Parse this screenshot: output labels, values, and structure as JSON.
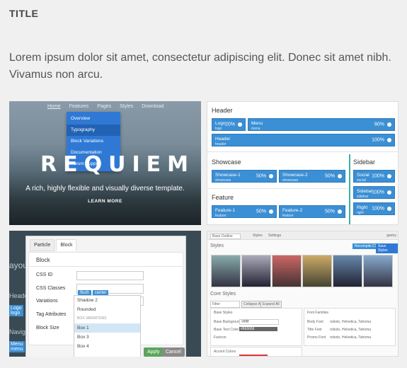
{
  "title": "TITLE",
  "lead": "Lorem ipsum dolor sit amet, consectetur adipiscing elit. Donec sit amet nibh. Vivamus non arcu.",
  "hero": {
    "nav": [
      "Home",
      "Features",
      "Pages",
      "Styles",
      "Download"
    ],
    "dropdown": [
      "Overview",
      "Typography",
      "Block Variations",
      "Documentation",
      "Forum Support"
    ],
    "word": "REQUIEM",
    "tagline": "A rich, highly flexible and visually diverse template.",
    "cta": "LEARN MORE"
  },
  "layout": {
    "header_label": "Header",
    "logo": {
      "name": "Logo",
      "sub": "logo",
      "pct": "20%"
    },
    "menu": {
      "name": "Menu",
      "sub": "menu",
      "pct": "80%"
    },
    "header": {
      "name": "Header",
      "sub": "header",
      "pct": "100%"
    },
    "showcase_label": "Showcase",
    "showcase1": {
      "name": "Showcase-1",
      "sub": "showcase",
      "pct": "50%"
    },
    "showcase2": {
      "name": "Showcase-2",
      "sub": "showcase",
      "pct": "50%"
    },
    "sidebar_label": "Sidebar",
    "social": {
      "name": "Social",
      "sub": "social",
      "pct": "100%"
    },
    "sidebar": {
      "name": "Sidebar",
      "sub": "sidebar",
      "pct": "100%"
    },
    "right": {
      "name": "Right",
      "sub": "right",
      "pct": "100%"
    },
    "feature_label": "Feature",
    "feature1": {
      "name": "Feature-1",
      "sub": "feature",
      "pct": "50%"
    },
    "feature2": {
      "name": "Feature-2",
      "sub": "feature",
      "pct": "50%"
    }
  },
  "modal": {
    "bg": [
      "ayou",
      "Heade",
      "Logo",
      "logo",
      "Navig",
      "Menu",
      "menu"
    ],
    "tabs": [
      "Particle",
      "Block"
    ],
    "section": "Block",
    "fields": [
      "CSS ID",
      "CSS Classes",
      "Variations",
      "Tag Attributes",
      "Block Size"
    ],
    "chips": [
      "flush",
      "center"
    ],
    "options": [
      "Shadow 2",
      "Rounded",
      "BOX VARIATIONS",
      "Box 1",
      "Box 3",
      "Box 4"
    ],
    "apply": "Apply",
    "cancel": "Cancel"
  },
  "styles": {
    "topbar": "Base Outline",
    "tab1": "Styles",
    "tab2": "Settings",
    "brand": "gantry",
    "heading": "Styles",
    "btn1": "Recompile CSS",
    "btn2": "Save Styles",
    "core": "Core Styles",
    "filter": "Filter",
    "collapse": "Collapse All",
    "expand": "Expand All",
    "base_styles": "Base Styles",
    "base_background": "Base Background",
    "base_text": "Base Text Color",
    "base_bg_val": "#ffffff",
    "base_text_val": "#666666",
    "favicon": "Favicon",
    "accent": "Accent Colors",
    "font_families": "Font Families",
    "body_font": "Body Font",
    "title_font": "Title Font",
    "promo_font": "Promo Font",
    "font_val": "roboto, Helvetica, Tahoma"
  }
}
